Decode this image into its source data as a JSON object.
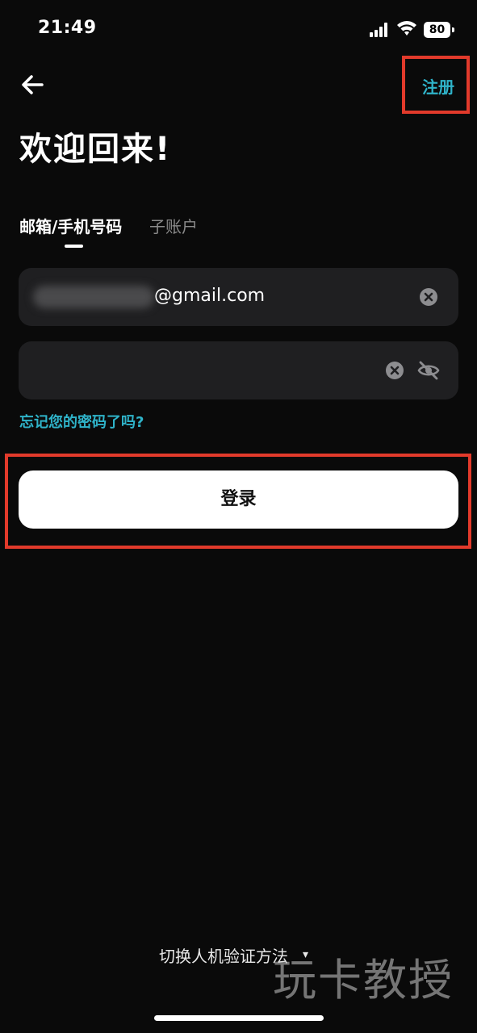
{
  "status_bar": {
    "time": "21:49",
    "battery": "80",
    "icons": [
      "signal-icon",
      "wifi-icon",
      "battery-icon"
    ]
  },
  "nav": {
    "back_icon": "arrow-left-icon",
    "register_label": "注册"
  },
  "page": {
    "title": "欢迎回来!"
  },
  "tabs": [
    {
      "label": "邮箱/手机号码",
      "active": true
    },
    {
      "label": "子账户",
      "active": false
    }
  ],
  "form": {
    "email": {
      "value_visible": "@gmail.com",
      "redacted": true
    },
    "password": {
      "value": ""
    },
    "forgot_label": "忘记您的密码了吗?",
    "login_label": "登录"
  },
  "footer": {
    "switch_label": "切换人机验证方法",
    "switch_icon": "chevron-down-icon",
    "watermark": "玩卡教授"
  },
  "colors": {
    "background": "#0a0a0a",
    "field": "#1f1f21",
    "accent": "#2fb3c9",
    "highlight": "#e23a2b",
    "button": "#ffffff"
  }
}
